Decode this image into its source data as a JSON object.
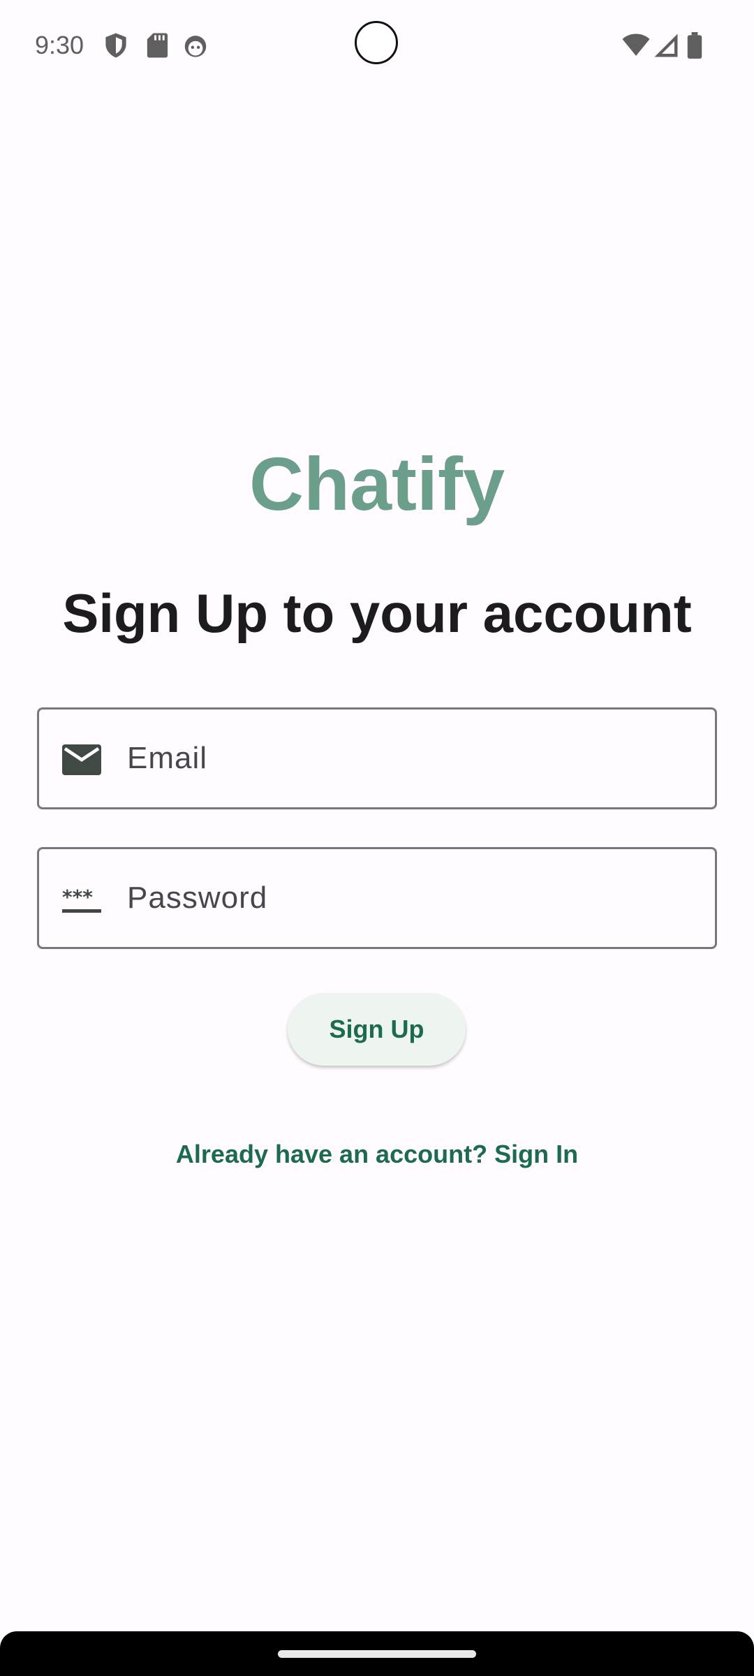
{
  "status_bar": {
    "time": "9:30",
    "icons_left": [
      "shield-icon",
      "sd-card-icon",
      "face-icon"
    ],
    "icons_right": [
      "wifi-icon",
      "cell-signal-icon",
      "battery-icon"
    ]
  },
  "app": {
    "title": "Chatify",
    "heading": "Sign Up to your account"
  },
  "form": {
    "email": {
      "placeholder": "Email",
      "value": "",
      "icon": "email-icon"
    },
    "password": {
      "placeholder": "Password",
      "value": "",
      "icon": "password-icon"
    },
    "submit_label": "Sign Up"
  },
  "footer": {
    "signin_link": "Already have an account? Sign In"
  },
  "colors": {
    "brand": "#6b9e8b",
    "accent": "#1d6b4f",
    "background": "#fffbfe",
    "button_bg": "#eef4f0"
  }
}
